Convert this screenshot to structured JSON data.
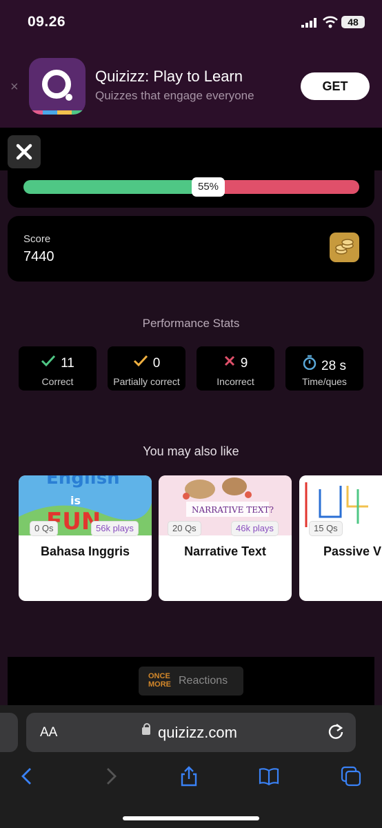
{
  "status_bar": {
    "time": "09.26",
    "battery": "48"
  },
  "app_banner": {
    "app_name": "Quizizz: Play to Learn",
    "subtitle": "Quizzes that engage everyone",
    "get_label": "GET",
    "close_symbol": "×",
    "icon": "quizizz-logo-icon"
  },
  "progress": {
    "percent": 55,
    "percent_label": "55%",
    "colors": {
      "correct": "#4fc785",
      "incorrect": "#e0506a"
    }
  },
  "score": {
    "label": "Score",
    "value": "7440",
    "icon": "coins-icon"
  },
  "performance": {
    "title": "Performance Stats",
    "stats": [
      {
        "icon": "check-icon",
        "value": "11",
        "label": "Correct",
        "color": "#4fc785"
      },
      {
        "icon": "check-icon",
        "value": "0",
        "label": "Partially correct",
        "color": "#f0b040"
      },
      {
        "icon": "cross-icon",
        "value": "9",
        "label": "Incorrect",
        "color": "#e0506a"
      },
      {
        "icon": "stopwatch-icon",
        "value": "28 s",
        "label": "Time/ques",
        "color": "#5aa8d8"
      }
    ]
  },
  "recommendations": {
    "title": "You may also like",
    "cards": [
      {
        "title": "Bahasa Inggris",
        "questions": "0 Qs",
        "plays": "56k plays"
      },
      {
        "title": "Narrative Text",
        "questions": "20 Qs",
        "plays": "46k plays"
      },
      {
        "title": "Passive V",
        "questions": "15 Qs",
        "plays": ""
      }
    ]
  },
  "reactions": {
    "logo_line1": "ONCE",
    "logo_line2": "MORE",
    "label": "Reactions"
  },
  "browser": {
    "text_size": "AA",
    "url": "quizizz.com"
  }
}
